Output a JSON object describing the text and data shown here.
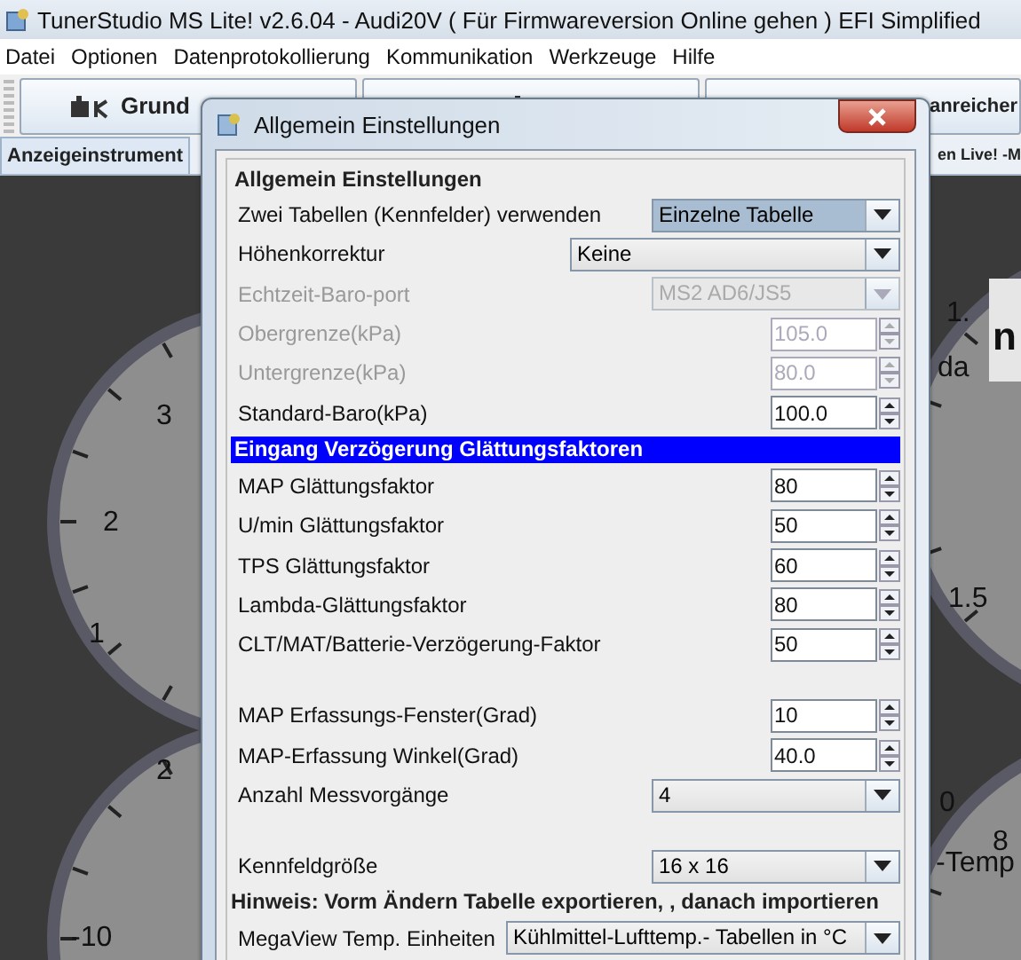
{
  "window": {
    "title": "TunerStudio MS Lite! v2.6.04 - Audi20V ( Für Firmwareversion Online gehen ) EFI Simplified"
  },
  "menu": [
    {
      "label": "Datei"
    },
    {
      "label": "Optionen"
    },
    {
      "label": "Datenprotokollierung"
    },
    {
      "label": "Kommunikation"
    },
    {
      "label": "Werkzeuge"
    },
    {
      "label": "Hilfe"
    }
  ],
  "toolbar": [
    {
      "kind": "icon_label",
      "label": "Grund"
    },
    {
      "kind": "icon"
    },
    {
      "kind": "label",
      "label": "anreicher"
    }
  ],
  "tabs": [
    {
      "label": "Anzeigeinstrument",
      "selected": true
    },
    {
      "label": "en Live! -M",
      "selected": false
    }
  ],
  "gauges": [
    {
      "labels": [
        "3",
        "2",
        "1"
      ]
    },
    {
      "labels": [
        "2",
        "-10"
      ]
    },
    {
      "labels": [
        "1.",
        "da",
        "1.5"
      ],
      "readout": "n"
    },
    {
      "labels": [
        "0",
        "8",
        "-Temp"
      ]
    }
  ],
  "dialog": {
    "title": "Allgemein Einstellungen",
    "group": "Allgemein Einstellungen",
    "rows": [
      {
        "kind": "combo",
        "label": "Zwei Tabellen (Kennfelder) verwenden",
        "value": "Einzelne Tabelle",
        "focused": true,
        "disabled": false
      },
      {
        "kind": "wide_combo",
        "label": "Höhenkorrektur",
        "value": "Keine",
        "focused": false,
        "disabled": false
      },
      {
        "kind": "combo",
        "label": "Echtzeit-Baro-port",
        "value": "MS2 AD6/JS5",
        "focused": false,
        "disabled": true
      },
      {
        "kind": "spinner",
        "label": "Obergrenze(kPa)",
        "value": "105.0",
        "disabled": true
      },
      {
        "kind": "spinner",
        "label": "Untergrenze(kPa)",
        "value": "80.0",
        "disabled": true
      },
      {
        "kind": "spinner",
        "label": "Standard-Baro(kPa)",
        "value": "100.0",
        "disabled": false
      },
      {
        "kind": "header",
        "label": "Eingang Verzögerung Glättungsfaktoren"
      },
      {
        "kind": "spinner",
        "label": "MAP Glättungsfaktor",
        "value": "80",
        "disabled": false
      },
      {
        "kind": "spinner",
        "label": "U/min Glättungsfaktor",
        "value": "50",
        "disabled": false
      },
      {
        "kind": "spinner",
        "label": "TPS Glättungsfaktor",
        "value": "60",
        "disabled": false
      },
      {
        "kind": "spinner",
        "label": "Lambda-Glättungsfaktor",
        "value": "80",
        "disabled": false
      },
      {
        "kind": "spinner",
        "label": "CLT/MAT/Batterie-Verzögerung-Faktor",
        "value": "50",
        "disabled": false
      },
      {
        "kind": "spacer"
      },
      {
        "kind": "spinner",
        "label": "MAP Erfassungs-Fenster(Grad)",
        "value": "10",
        "disabled": false
      },
      {
        "kind": "spinner",
        "label": "MAP-Erfassung Winkel(Grad)",
        "value": "40.0",
        "disabled": false
      },
      {
        "kind": "combo",
        "label": "Anzahl Messvorgänge",
        "value": "4",
        "focused": false,
        "disabled": false
      },
      {
        "kind": "spacer"
      },
      {
        "kind": "combo",
        "label": "Kennfeldgröße",
        "value": "16 x 16",
        "focused": false,
        "disabled": false
      },
      {
        "kind": "note",
        "label": "Hinweis: Vorm Ändern Tabelle exportieren, , danach importieren"
      },
      {
        "kind": "long_combo",
        "label": "MegaView Temp. Einheiten",
        "value": "Kühlmittel-Lufttemp.- Tabellen in °C",
        "focused": false,
        "disabled": false
      }
    ]
  }
}
